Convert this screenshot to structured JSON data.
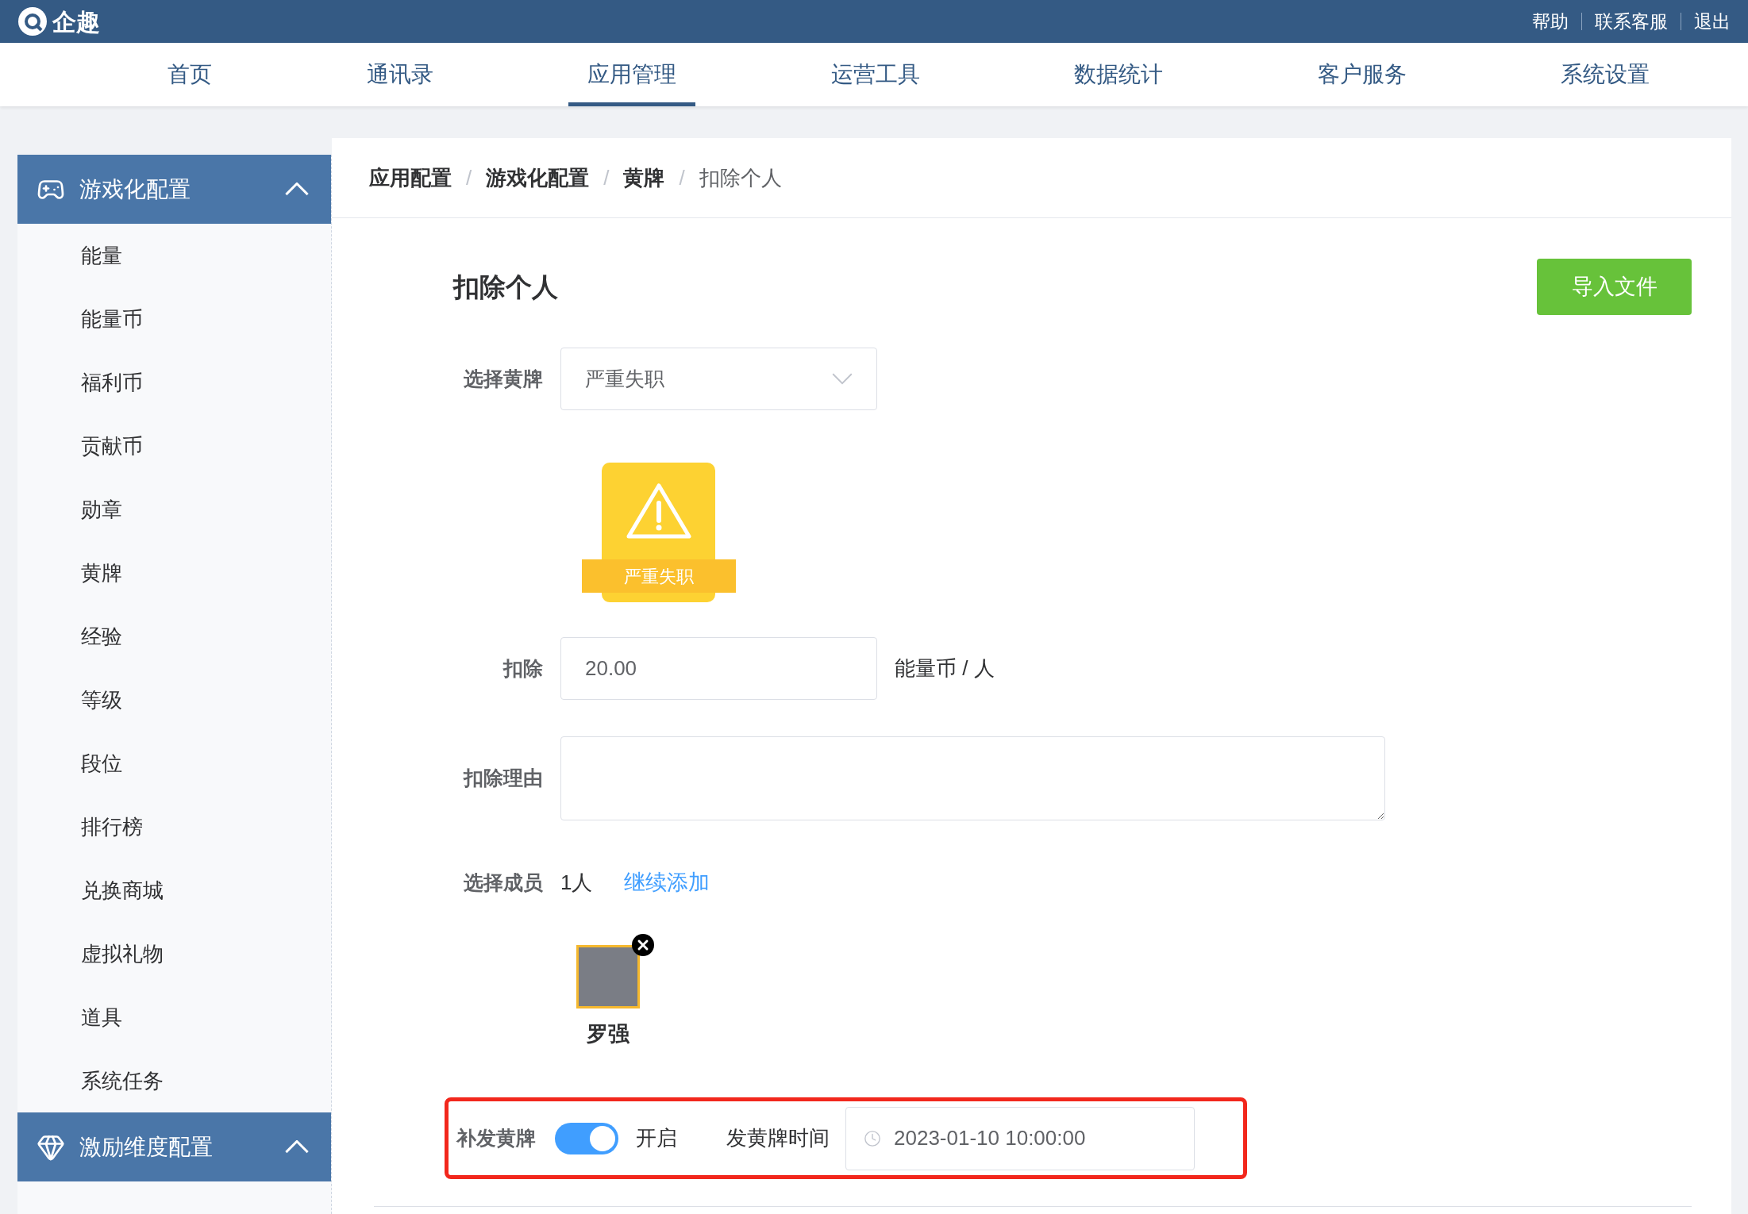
{
  "top_bar": {
    "brand": "企趣",
    "links": [
      "帮助",
      "联系客服",
      "退出"
    ]
  },
  "nav": [
    {
      "label": "首页",
      "selected": false
    },
    {
      "label": "通讯录",
      "selected": false
    },
    {
      "label": "应用管理",
      "selected": true
    },
    {
      "label": "运营工具",
      "selected": false
    },
    {
      "label": "数据统计",
      "selected": false
    },
    {
      "label": "客户服务",
      "selected": false
    },
    {
      "label": "系统设置",
      "selected": false
    }
  ],
  "sidebar": [
    {
      "kind": "gamepad",
      "label": "游戏化配置",
      "expanded": true,
      "children": [
        {
          "label": "能量"
        },
        {
          "label": "能量币"
        },
        {
          "label": "福利币"
        },
        {
          "label": "贡献币"
        },
        {
          "label": "勋章"
        },
        {
          "label": "黄牌"
        },
        {
          "label": "经验"
        },
        {
          "label": "等级"
        },
        {
          "label": "段位"
        },
        {
          "label": "排行榜"
        },
        {
          "label": "兑换商城"
        },
        {
          "label": "虚拟礼物"
        },
        {
          "label": "道具"
        },
        {
          "label": "系统任务"
        }
      ]
    },
    {
      "kind": "gem",
      "label": "激励维度配置",
      "expanded": true
    }
  ],
  "breadcrumb": {
    "separator": "/",
    "items": [
      "应用配置",
      "游戏化配置",
      "黄牌",
      "扣除个人"
    ]
  },
  "page_title": "扣除个人",
  "import_button": "导入文件",
  "form": {
    "card_label": "选择黄牌",
    "card_value": "严重失职",
    "badge_label": "严重失职",
    "deduct_label": "扣除",
    "deduct_value": "20.00",
    "deduct_unit": "能量币 / 人",
    "reason_label": "扣除理由",
    "members_label": "选择成员",
    "members_count": "1人",
    "add_more": "继续添加",
    "members": [
      {
        "name": "罗强"
      }
    ],
    "reissue_label": "补发黄牌",
    "reissue_on": true,
    "reissue_state": "开启",
    "time_label": "发黄牌时间",
    "time_value": "2023-01-10 10:00:00"
  }
}
